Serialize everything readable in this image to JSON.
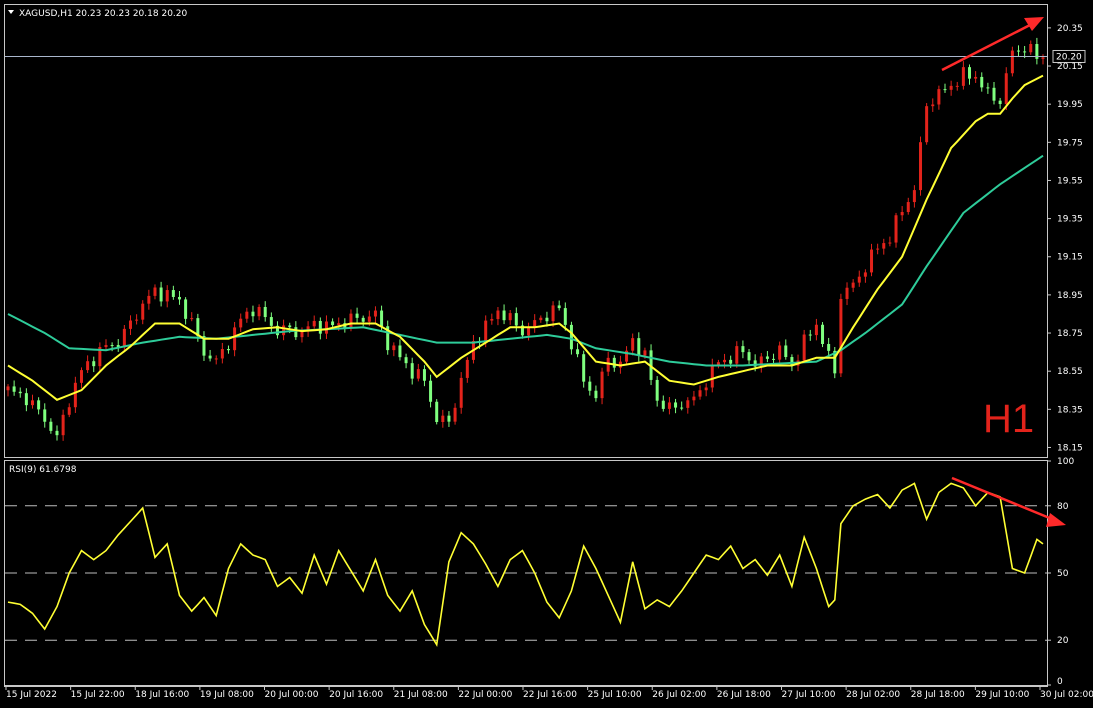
{
  "header": {
    "symbol_line": "XAGUSD,H1  20.23 20.23 20.18 20.20",
    "timeframe_big": "H1",
    "current_price": "20.20"
  },
  "rsi_header": "RSI(9) 61.6798",
  "colors": {
    "bull": "#e3231b",
    "bear": "#7fff7f",
    "ma_fast": "#ffff33",
    "ma_slow": "#2ecc9a",
    "rsi": "#ffff33",
    "arrow": "#ff2a2a",
    "frame": "#c8c8c8",
    "price_line": "#a9b6cc"
  },
  "chart_data": [
    {
      "type": "candlestick",
      "title": "XAGUSD,H1",
      "ylim": [
        18.1,
        20.47
      ],
      "y_ticks": [
        "20.35",
        "20.15",
        "19.95",
        "19.75",
        "19.55",
        "19.35",
        "19.15",
        "18.95",
        "18.75",
        "18.55",
        "18.35",
        "18.15"
      ],
      "x_ticks": [
        "15 Jul 2022",
        "15 Jul 22:00",
        "18 Jul 16:00",
        "19 Jul 08:00",
        "20 Jul 00:00",
        "20 Jul 16:00",
        "21 Jul 08:00",
        "22 Jul 00:00",
        "22 Jul 16:00",
        "25 Jul 10:00",
        "26 Jul 02:00",
        "26 Jul 18:00",
        "27 Jul 10:00",
        "28 Jul 02:00",
        "28 Jul 18:00",
        "29 Jul 10:00",
        "30 Jul 02:00"
      ],
      "close_path": [
        [
          0,
          18.45
        ],
        [
          3,
          18.41
        ],
        [
          6,
          18.3
        ],
        [
          8,
          18.2
        ],
        [
          10,
          18.4
        ],
        [
          12,
          18.55
        ],
        [
          14,
          18.62
        ],
        [
          16,
          18.68
        ],
        [
          18,
          18.7
        ],
        [
          20,
          18.8
        ],
        [
          22,
          18.9
        ],
        [
          24,
          18.97
        ],
        [
          26,
          18.95
        ],
        [
          28,
          18.92
        ],
        [
          30,
          18.8
        ],
        [
          32,
          18.65
        ],
        [
          34,
          18.6
        ],
        [
          36,
          18.7
        ],
        [
          38,
          18.82
        ],
        [
          40,
          18.88
        ],
        [
          42,
          18.83
        ],
        [
          44,
          18.76
        ],
        [
          46,
          18.77
        ],
        [
          48,
          18.75
        ],
        [
          50,
          18.8
        ],
        [
          52,
          18.78
        ],
        [
          54,
          18.8
        ],
        [
          56,
          18.82
        ],
        [
          58,
          18.83
        ],
        [
          60,
          18.85
        ],
        [
          62,
          18.7
        ],
        [
          64,
          18.62
        ],
        [
          66,
          18.55
        ],
        [
          68,
          18.5
        ],
        [
          70,
          18.3
        ],
        [
          72,
          18.28
        ],
        [
          74,
          18.5
        ],
        [
          76,
          18.7
        ],
        [
          78,
          18.78
        ],
        [
          80,
          18.87
        ],
        [
          82,
          18.82
        ],
        [
          84,
          18.76
        ],
        [
          86,
          18.8
        ],
        [
          88,
          18.85
        ],
        [
          90,
          18.88
        ],
        [
          92,
          18.7
        ],
        [
          94,
          18.5
        ],
        [
          96,
          18.42
        ],
        [
          98,
          18.62
        ],
        [
          100,
          18.58
        ],
        [
          102,
          18.72
        ],
        [
          104,
          18.62
        ],
        [
          106,
          18.4
        ],
        [
          108,
          18.35
        ],
        [
          110,
          18.38
        ],
        [
          112,
          18.4
        ],
        [
          114,
          18.5
        ],
        [
          116,
          18.6
        ],
        [
          118,
          18.62
        ],
        [
          120,
          18.66
        ],
        [
          122,
          18.58
        ],
        [
          124,
          18.62
        ],
        [
          126,
          18.66
        ],
        [
          128,
          18.58
        ],
        [
          130,
          18.7
        ],
        [
          132,
          18.8
        ],
        [
          134,
          18.62
        ],
        [
          135,
          18.55
        ],
        [
          136,
          18.95
        ],
        [
          138,
          19.0
        ],
        [
          140,
          19.1
        ],
        [
          142,
          19.2
        ],
        [
          144,
          19.25
        ],
        [
          146,
          19.4
        ],
        [
          148,
          19.5
        ],
        [
          150,
          19.95
        ],
        [
          152,
          20.0
        ],
        [
          154,
          20.05
        ],
        [
          156,
          20.1
        ],
        [
          158,
          20.1
        ],
        [
          160,
          20.0
        ],
        [
          162,
          19.97
        ],
        [
          164,
          20.22
        ],
        [
          166,
          20.25
        ],
        [
          168,
          20.2
        ],
        [
          169,
          20.2
        ]
      ],
      "series": [
        {
          "name": "",
          "values": [
            [
              0,
              18.58
            ],
            [
              4,
              18.5
            ],
            [
              8,
              18.4
            ],
            [
              12,
              18.45
            ],
            [
              16,
              18.58
            ],
            [
              20,
              18.68
            ],
            [
              24,
              18.8
            ],
            [
              28,
              18.8
            ],
            [
              32,
              18.72
            ],
            [
              36,
              18.72
            ],
            [
              40,
              18.77
            ],
            [
              44,
              18.78
            ],
            [
              48,
              18.76
            ],
            [
              52,
              18.77
            ],
            [
              56,
              18.8
            ],
            [
              60,
              18.8
            ],
            [
              64,
              18.73
            ],
            [
              68,
              18.6
            ],
            [
              70,
              18.52
            ],
            [
              74,
              18.62
            ],
            [
              78,
              18.7
            ],
            [
              82,
              18.78
            ],
            [
              86,
              18.78
            ],
            [
              90,
              18.8
            ],
            [
              92,
              18.75
            ],
            [
              96,
              18.6
            ],
            [
              100,
              18.58
            ],
            [
              104,
              18.6
            ],
            [
              108,
              18.5
            ],
            [
              112,
              18.48
            ],
            [
              116,
              18.52
            ],
            [
              120,
              18.55
            ],
            [
              124,
              18.58
            ],
            [
              128,
              18.58
            ],
            [
              132,
              18.62
            ],
            [
              135,
              18.62
            ],
            [
              138,
              18.78
            ],
            [
              142,
              18.98
            ],
            [
              146,
              19.15
            ],
            [
              150,
              19.45
            ],
            [
              154,
              19.72
            ],
            [
              158,
              19.86
            ],
            [
              160,
              19.9
            ],
            [
              162,
              19.9
            ],
            [
              164,
              19.98
            ],
            [
              166,
              20.05
            ],
            [
              169,
              20.1
            ]
          ]
        },
        {
          "name": "",
          "values": [
            [
              0,
              18.85
            ],
            [
              6,
              18.75
            ],
            [
              10,
              18.67
            ],
            [
              16,
              18.66
            ],
            [
              22,
              18.7
            ],
            [
              28,
              18.73
            ],
            [
              34,
              18.72
            ],
            [
              40,
              18.74
            ],
            [
              46,
              18.76
            ],
            [
              52,
              18.77
            ],
            [
              58,
              18.78
            ],
            [
              64,
              18.74
            ],
            [
              70,
              18.7
            ],
            [
              76,
              18.7
            ],
            [
              82,
              18.72
            ],
            [
              88,
              18.74
            ],
            [
              92,
              18.72
            ],
            [
              96,
              18.67
            ],
            [
              102,
              18.64
            ],
            [
              108,
              18.6
            ],
            [
              114,
              18.58
            ],
            [
              120,
              18.58
            ],
            [
              126,
              18.59
            ],
            [
              132,
              18.6
            ],
            [
              136,
              18.66
            ],
            [
              140,
              18.75
            ],
            [
              146,
              18.9
            ],
            [
              150,
              19.1
            ],
            [
              156,
              19.38
            ],
            [
              162,
              19.53
            ],
            [
              169,
              19.68
            ]
          ]
        }
      ]
    },
    {
      "type": "line",
      "title": "RSI(9) 61.6798",
      "ylim": [
        0,
        100
      ],
      "y_ticks": [
        100,
        80,
        50,
        20,
        0
      ],
      "levels": [
        80,
        50,
        20
      ],
      "series": [
        {
          "name": "RSI(9)",
          "values": [
            [
              0,
              37
            ],
            [
              2,
              36
            ],
            [
              4,
              32
            ],
            [
              6,
              25
            ],
            [
              8,
              35
            ],
            [
              10,
              50
            ],
            [
              12,
              60
            ],
            [
              14,
              56
            ],
            [
              16,
              60
            ],
            [
              18,
              67
            ],
            [
              20,
              73
            ],
            [
              22,
              79
            ],
            [
              24,
              57
            ],
            [
              26,
              63
            ],
            [
              28,
              40
            ],
            [
              30,
              33
            ],
            [
              32,
              39
            ],
            [
              34,
              31
            ],
            [
              36,
              52
            ],
            [
              38,
              63
            ],
            [
              40,
              58
            ],
            [
              42,
              56
            ],
            [
              44,
              44
            ],
            [
              46,
              48
            ],
            [
              48,
              41
            ],
            [
              50,
              58
            ],
            [
              52,
              45
            ],
            [
              54,
              60
            ],
            [
              56,
              51
            ],
            [
              58,
              42
            ],
            [
              60,
              56
            ],
            [
              62,
              40
            ],
            [
              64,
              33
            ],
            [
              66,
              42
            ],
            [
              68,
              27
            ],
            [
              70,
              18
            ],
            [
              72,
              55
            ],
            [
              74,
              68
            ],
            [
              76,
              63
            ],
            [
              78,
              54
            ],
            [
              80,
              44
            ],
            [
              82,
              56
            ],
            [
              84,
              60
            ],
            [
              86,
              50
            ],
            [
              88,
              37
            ],
            [
              90,
              30
            ],
            [
              92,
              42
            ],
            [
              94,
              62
            ],
            [
              96,
              52
            ],
            [
              98,
              40
            ],
            [
              100,
              28
            ],
            [
              102,
              55
            ],
            [
              104,
              34
            ],
            [
              106,
              38
            ],
            [
              108,
              35
            ],
            [
              110,
              42
            ],
            [
              112,
              50
            ],
            [
              114,
              58
            ],
            [
              116,
              56
            ],
            [
              118,
              62
            ],
            [
              120,
              52
            ],
            [
              122,
              56
            ],
            [
              124,
              49
            ],
            [
              126,
              58
            ],
            [
              128,
              44
            ],
            [
              130,
              66
            ],
            [
              132,
              52
            ],
            [
              134,
              35
            ],
            [
              135,
              38
            ],
            [
              136,
              72
            ],
            [
              138,
              80
            ],
            [
              140,
              83
            ],
            [
              142,
              85
            ],
            [
              144,
              79
            ],
            [
              146,
              87
            ],
            [
              148,
              90
            ],
            [
              150,
              74
            ],
            [
              152,
              86
            ],
            [
              154,
              90
            ],
            [
              156,
              88
            ],
            [
              158,
              80
            ],
            [
              160,
              86
            ],
            [
              162,
              84
            ],
            [
              164,
              52
            ],
            [
              166,
              50
            ],
            [
              168,
              65
            ],
            [
              169,
              63
            ]
          ]
        }
      ]
    }
  ]
}
